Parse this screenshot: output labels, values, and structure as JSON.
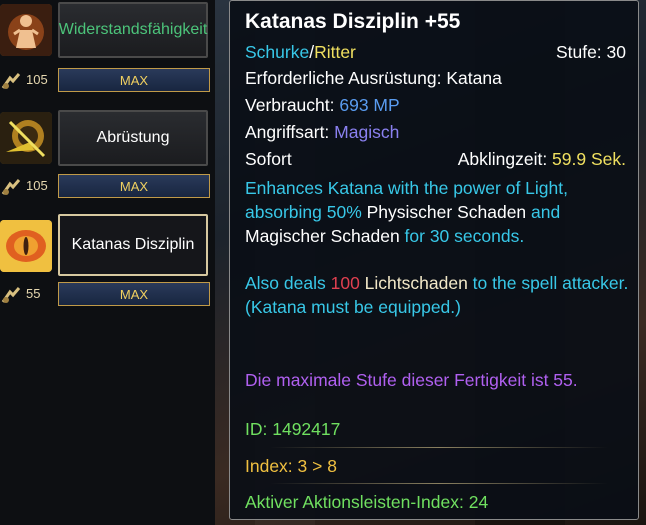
{
  "skills": [
    {
      "name": "Widerstandsfähigkeit",
      "level": "105",
      "max": "MAX"
    },
    {
      "name": "Abrüstung",
      "level": "105",
      "max": "MAX"
    },
    {
      "name": "Katanas Disziplin",
      "level": "55",
      "max": "MAX"
    }
  ],
  "tooltip": {
    "title": "Katanas Disziplin +55",
    "class1": "Schurke",
    "sep": "/",
    "class2": "Ritter",
    "level": "Stufe: 30",
    "equipment": "Erforderliche Ausrüstung: Katana",
    "consumes_label": "Verbraucht: ",
    "consumes_value": "693 MP",
    "attack_label": "Angriffsart: ",
    "attack_value": "Magisch",
    "cast": "Sofort",
    "cooldown_label": "Abklingzeit: ",
    "cooldown_value": "59.9 Sek.",
    "desc1_a": "Enhances Katana with the power of Light, absorbing ",
    "desc1_b": "50%",
    "desc1_c": " Physischer Schaden",
    "desc1_d": " and ",
    "desc1_e": "Magischer Schaden",
    "desc1_f": " for 30 seconds.",
    "desc2_a": "Also deals ",
    "desc2_b": "100",
    "desc2_c": " Lichtschaden",
    "desc2_d": " to the spell attacker.",
    "desc2_e": "(Katana must be equipped.)",
    "maxlevel": "Die maximale Stufe dieser Fertigkeit ist 55.",
    "id": "ID: 1492417",
    "index": "Index: 3 > 8",
    "action_index": "Aktiver Aktionsleisten-Index: 24"
  },
  "colors": {
    "cyan": "#38c8e8",
    "yellow": "#f0e060",
    "blue": "#5a9cf0",
    "purple": "#8a80f0",
    "red": "#e04050",
    "violet": "#b060f0",
    "lime": "#70e060",
    "gold": "#f0c040"
  },
  "icons": [
    "resistance-icon",
    "disarm-icon",
    "katana-discipline-icon",
    "skill-level-icon"
  ]
}
